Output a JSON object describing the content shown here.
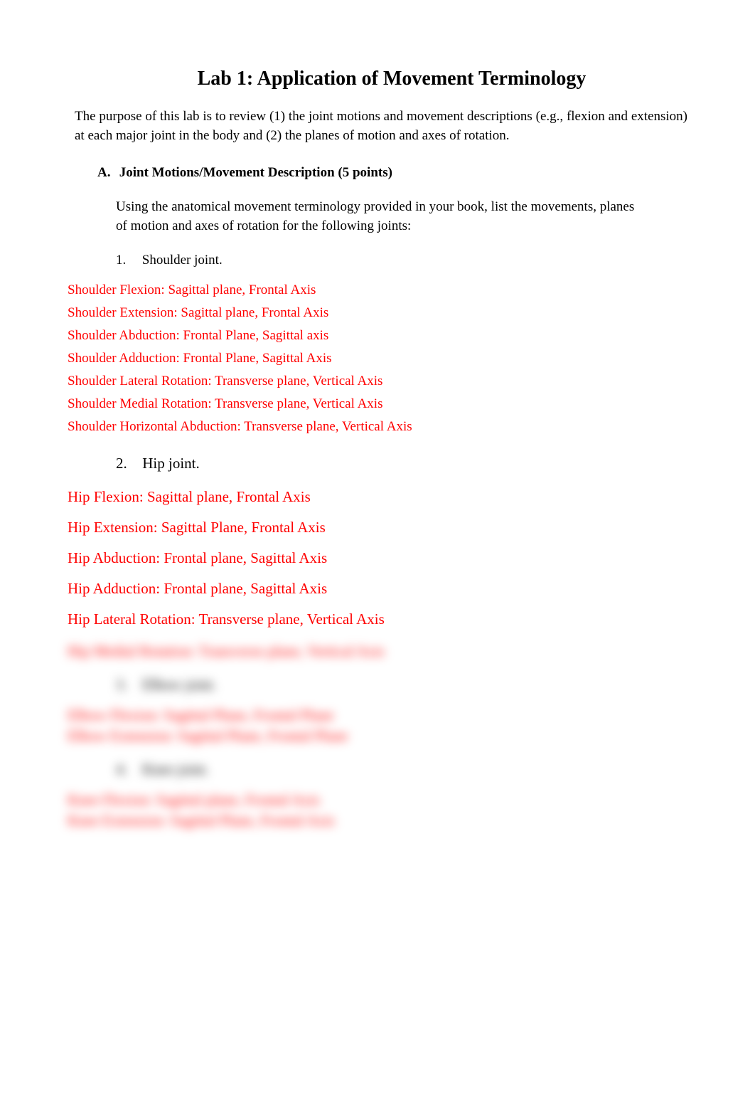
{
  "title": "Lab 1: Application of Movement Terminology",
  "intro": "The purpose of this lab is to review (1) the joint motions and movement descriptions (e.g., flexion and extension) at each major joint in the body and (2) the planes of motion and axes of rotation.",
  "section": {
    "letter": "A.",
    "heading": "Joint Motions/Movement Description  (5 points)",
    "instructions": "Using the anatomical movement terminology provided in your book, list the movements, planes of motion and axes of rotation for the following joints:"
  },
  "items": [
    {
      "num": "1.",
      "label": "Shoulder joint.",
      "answers": [
        "Shoulder Flexion: Sagittal plane, Frontal Axis",
        "Shoulder Extension: Sagittal plane, Frontal Axis",
        "Shoulder Abduction: Frontal Plane, Sagittal axis",
        "Shoulder Adduction: Frontal Plane, Sagittal Axis",
        "Shoulder Lateral Rotation: Transverse plane, Vertical Axis",
        "Shoulder Medial Rotation: Transverse plane, Vertical Axis",
        "Shoulder Horizontal Abduction: Transverse plane, Vertical Axis"
      ]
    },
    {
      "num": "2.",
      "label": "Hip joint.",
      "answers": [
        "Hip Flexion: Sagittal plane, Frontal Axis",
        "Hip Extension: Sagittal Plane, Frontal Axis",
        "Hip Abduction: Frontal plane, Sagittal Axis",
        "Hip Adduction: Frontal plane, Sagittal Axis",
        "Hip Lateral Rotation: Transverse plane, Vertical Axis"
      ]
    }
  ],
  "blurred": {
    "line_after_hip": "Hip Medial Rotation: Transverse plane, Vertical Axis",
    "item3": {
      "num": "3.",
      "label": "Elbow joint.",
      "answers": [
        "Elbow Flexion: Sagittal Plane, Frontal Plane",
        "Elbow Extension: Sagittal Plane, Frontal Plane"
      ]
    },
    "item4": {
      "num": "4.",
      "label": "Knee joint.",
      "answers": [
        "Knee Flexion: Sagittal plane, Frontal Axis",
        "Knee Extension: Sagittal Plane, Frontal Axis"
      ]
    }
  }
}
